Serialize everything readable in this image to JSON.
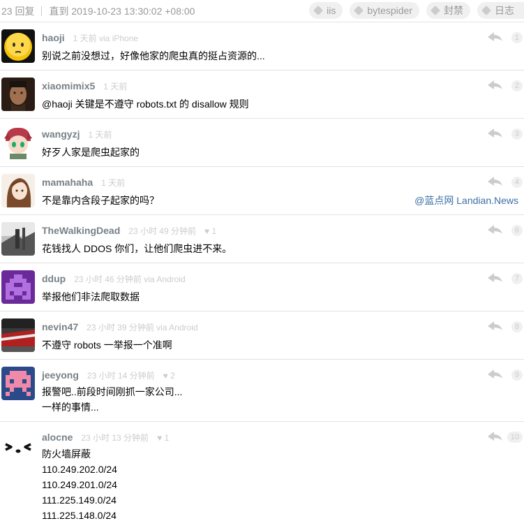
{
  "header": {
    "reply_count": "23 回复",
    "until": "直到 2019-10-23 13:30:02 +08:00",
    "tags": [
      "iis",
      "bytespider",
      "封禁",
      "日志"
    ]
  },
  "watermark": "@蓝点网 Landian.News",
  "replies": [
    {
      "user": "haoji",
      "ago": "1 天前 via iPhone",
      "heart": "",
      "lines": [
        "别说之前没想过，好像他家的爬虫真的挺占资源的..."
      ],
      "num": "1",
      "avatar_icon": "smiley-avatar-icon"
    },
    {
      "user": "xiaomimix5",
      "ago": "1 天前",
      "heart": "",
      "lines": [
        "@haoji 关键是不遵守 robots.txt 的 disallow 规则"
      ],
      "num": "2",
      "avatar_icon": "portrait-avatar-icon"
    },
    {
      "user": "wangyzj",
      "ago": "1 天前",
      "heart": "",
      "lines": [
        "好歹人家是爬虫起家的"
      ],
      "num": "3",
      "avatar_icon": "anime-avatar-icon"
    },
    {
      "user": "mamahaha",
      "ago": "1 天前",
      "heart": "",
      "lines": [
        "不是靠内含段子起家的吗？"
      ],
      "num": "4",
      "avatar_icon": "anime-girl-avatar-icon"
    },
    {
      "user": "TheWalkingDead",
      "ago": "23 小时 49 分钟前",
      "heart": "♥ 1",
      "lines": [
        "花钱找人 DDOS 你们，让他们爬虫进不来。"
      ],
      "num": "6",
      "avatar_icon": "photo-avatar-icon"
    },
    {
      "user": "ddup",
      "ago": "23 小时 46 分钟前 via Android",
      "heart": "",
      "lines": [
        "举报他们非法爬取数据"
      ],
      "num": "7",
      "avatar_icon": "pixel-invader-avatar-icon"
    },
    {
      "user": "nevin47",
      "ago": "23 小时 39 分钟前 via Android",
      "heart": "",
      "lines": [
        "不遵守 robots 一举报一个准啊"
      ],
      "num": "8",
      "avatar_icon": "car-avatar-icon"
    },
    {
      "user": "jeeyong",
      "ago": "23 小时 14 分钟前",
      "heart": "♥ 2",
      "lines": [
        "报警吧..前段时间刚抓一家公司...",
        "一样的事情..."
      ],
      "num": "9",
      "avatar_icon": "pixel-pink-avatar-icon"
    },
    {
      "user": "alocne",
      "ago": "23 小时 13 分钟前",
      "heart": "♥ 1",
      "lines": [
        "防火墙屏蔽",
        "110.249.202.0/24",
        "110.249.201.0/24",
        "111.225.149.0/24",
        "111.225.148.0/24"
      ],
      "num": "10",
      "avatar_icon": "face-emoticon-avatar-icon"
    }
  ]
}
